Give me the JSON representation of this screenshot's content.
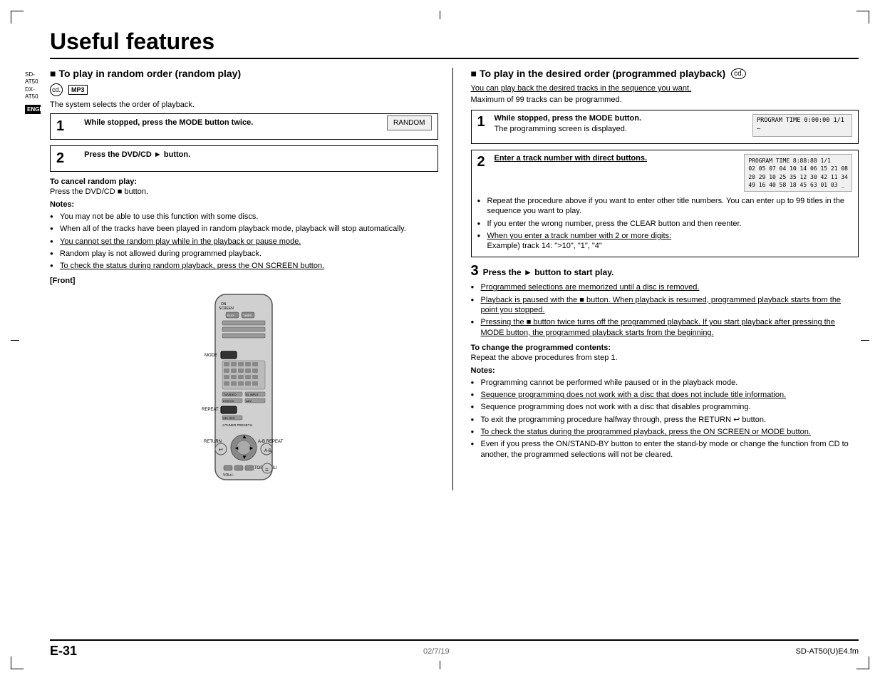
{
  "page": {
    "title": "Useful features",
    "model1": "SD-AT50",
    "model2": "DX-AT50",
    "language": "ENGLISH",
    "page_number": "E-31",
    "footer_date": "02/7/19",
    "footer_file": "SD-AT50(U)E4.fm"
  },
  "left_section": {
    "heading": "To play in random order (random play)",
    "intro": "The system selects the order of playback.",
    "step1": {
      "number": "1",
      "text": "While stopped, press the MODE button twice.",
      "display": "RANDOM"
    },
    "step2": {
      "number": "2",
      "text": "Press the DVD/CD ► button."
    },
    "cancel_heading": "To cancel random play:",
    "cancel_text": "Press the DVD/CD ■ button.",
    "notes_heading": "Notes:",
    "notes": [
      "You may not be able to use this function with some discs.",
      "When all of the tracks have been played in random playback mode, playback will stop automatically.",
      "You cannot set the random play while in the playback or pause mode.",
      "Random play is not allowed during programmed playback.",
      "To check the status during random playback, press the ON SCREEN button."
    ],
    "front_label": "[Front]"
  },
  "right_section": {
    "heading": "To play in the desired order (programmed playback)",
    "intro1": "You can play back the desired tracks in the sequence you want.",
    "intro2": "Maximum of 99 tracks can be programmed.",
    "step1": {
      "number": "1",
      "text": "While stopped, press the MODE button.",
      "subtext": "The programming screen is displayed.",
      "display_line1": "PROGRAM  TIME  0:00:00  1/1",
      "display_line2": "–"
    },
    "step2": {
      "number": "2",
      "text": "Enter a track number with direct buttons.",
      "display_line1": "PROGRAM  TIME  8:88:88  1/1",
      "display_line2": "02 05 07 04 10 14 06 15 21 08",
      "display_line3": "20 29 10 25 35 12 30 42 11 34",
      "display_line4": "49 16 40 58 18 45 63 01 03 _"
    },
    "step2_bullets": [
      "Repeat the procedure above if you want to enter other title numbers. You can enter up to 99 titles in the sequence you want to play.",
      "If you enter the wrong number, press the CLEAR button and then reenter.",
      "When you enter a track number with 2 or more digits: Example) track 14: \">10\", \"1\", \"4\""
    ],
    "step3": {
      "number": "3",
      "text": "Press the ► button to start play."
    },
    "step3_bullets": [
      "Programmed selections are memorized until a disc is removed.",
      "Playback is paused with the ■ button. When playback is resumed, programmed playback starts from the point you stopped.",
      "Pressing the ■ button twice turns off the programmed playback. If you start playback after pressing the MODE button, the programmed playback starts from the beginning."
    ],
    "change_heading": "To change the programmed contents:",
    "change_text": "Repeat the above procedures from step 1.",
    "notes_heading": "Notes:",
    "notes": [
      "Programming cannot be performed while paused or in the playback mode.",
      "Sequence programming does not work with a disc that does not include title information.",
      "Sequence programming does not work with a disc that disables programming.",
      "To exit the programming procedure halfway through, press the RETURN ↩ button.",
      "To check the status during the programmed playback, press the ON SCREEN or MODE button.",
      "Even if you press the ON/STAND-BY button to enter the stand-by mode or change the function from CD to another, the programmed selections will not be cleared."
    ]
  }
}
